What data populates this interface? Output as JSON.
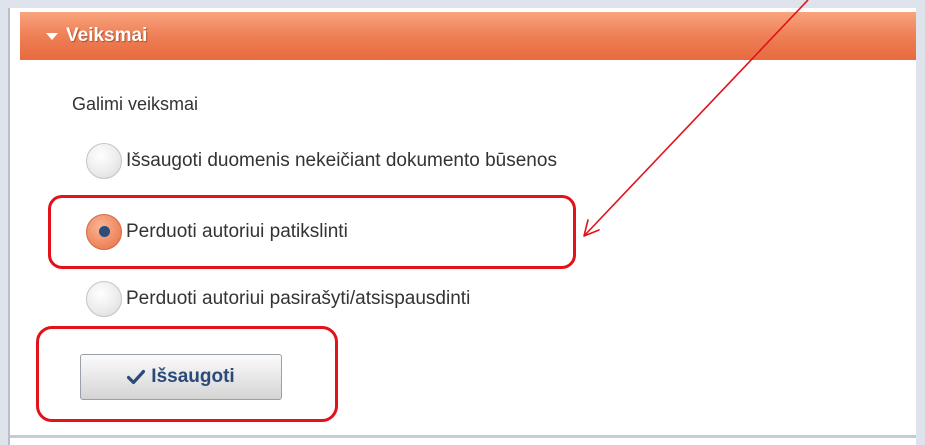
{
  "panel": {
    "title": "Veiksmai",
    "section_label": "Galimi veiksmai"
  },
  "options": [
    {
      "label": "Išsaugoti duomenis nekeičiant dokumento būsenos",
      "checked": false
    },
    {
      "label": "Perduoti autoriui patikslinti",
      "checked": true
    },
    {
      "label": "Perduoti autoriui pasirašyti/atsispausdinti",
      "checked": false
    }
  ],
  "save_button": {
    "label": "Išsaugoti",
    "icon": "check-icon"
  },
  "colors": {
    "header_orange": "#ee7f55",
    "annotation_red": "#e3121a",
    "button_text": "#2b4a78"
  }
}
